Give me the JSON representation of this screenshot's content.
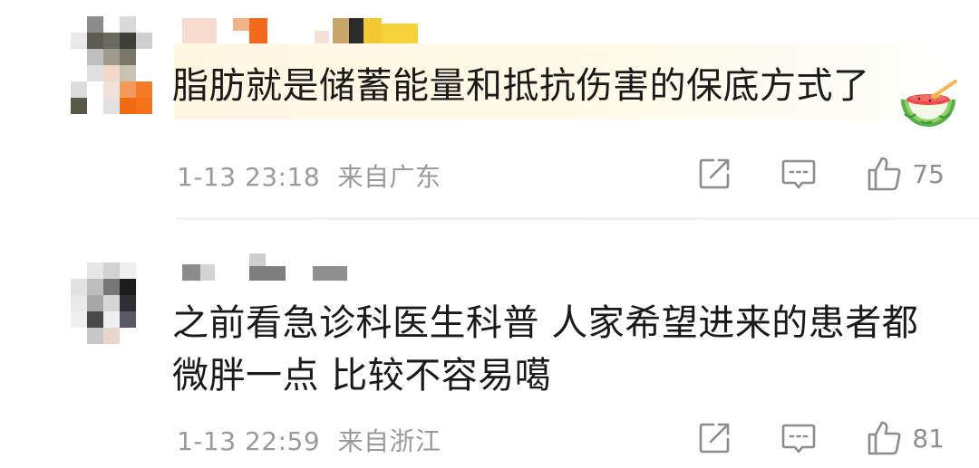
{
  "comments": [
    {
      "text": "脂肪就是储蓄能量和抵抗伤害的保底方式了",
      "time": "1-13 23:18",
      "location": "来自广东",
      "likes": "75",
      "emoji_icon": "watermelon-icon"
    },
    {
      "lines": [
        "之前看急诊科医生科普 人家希望进来的患者都",
        "微胖一点 比较不容易噶"
      ],
      "time": "1-13 22:59",
      "location": "来自浙江",
      "likes": "81"
    }
  ],
  "icons": {
    "share": "share-icon",
    "comment": "comment-icon",
    "like": "thumbs-up-icon"
  },
  "colors": {
    "text": "#1a1a1a",
    "meta": "#9a9a9a",
    "highlight": "#fff6e2"
  }
}
